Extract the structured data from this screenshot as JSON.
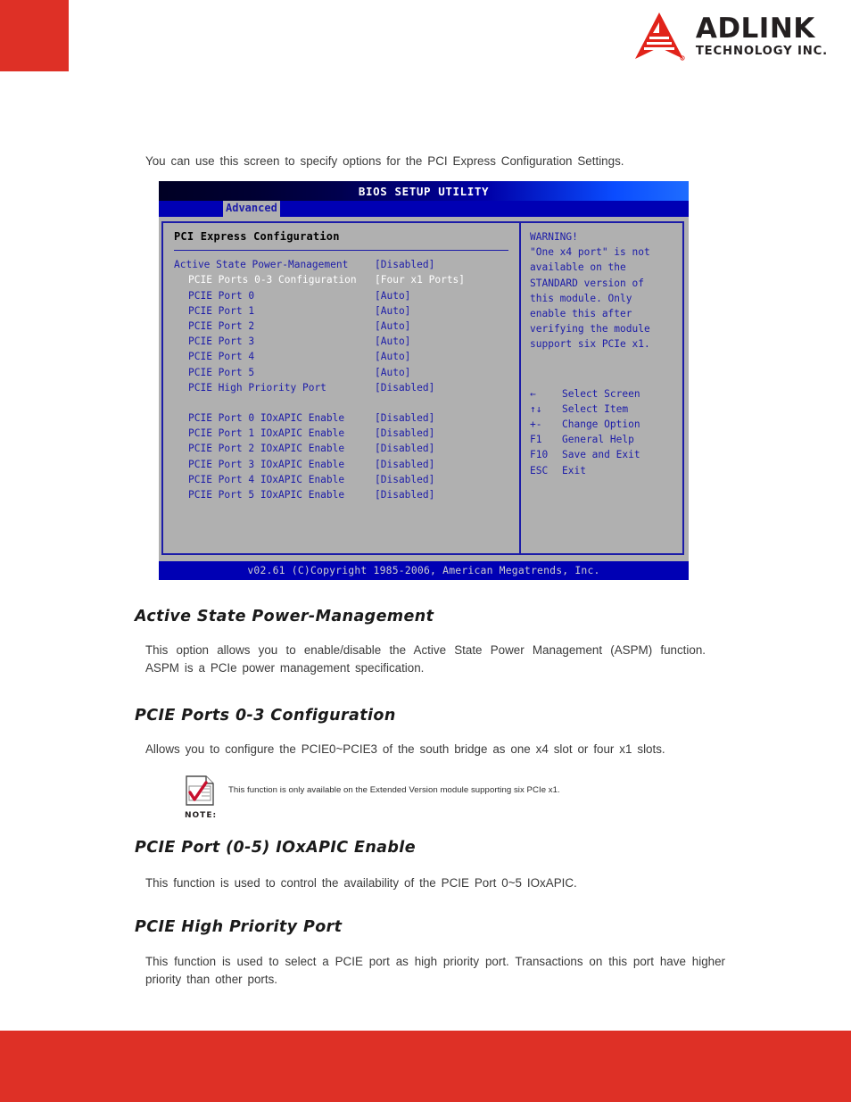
{
  "header": {
    "logo_name": "ADLINK",
    "logo_sub": "TECHNOLOGY INC.",
    "brand_red": "#DE3026"
  },
  "intro": "You can use this screen to specify options for the PCI Express Configuration Settings.",
  "bios": {
    "title": "BIOS SETUP UTILITY",
    "tab": "Advanced",
    "section_title": "PCI Express Configuration",
    "rows": [
      {
        "label": "Active State Power-Management",
        "value": "[Disabled]",
        "indent": false,
        "selected": false
      },
      {
        "label": "PCIE Ports 0-3 Configuration",
        "value": "[Four x1 Ports]",
        "indent": true,
        "selected": true
      },
      {
        "label": "PCIE Port 0",
        "value": "[Auto]",
        "indent": true,
        "selected": false
      },
      {
        "label": "PCIE Port 1",
        "value": "[Auto]",
        "indent": true,
        "selected": false
      },
      {
        "label": "PCIE Port 2",
        "value": "[Auto]",
        "indent": true,
        "selected": false
      },
      {
        "label": "PCIE Port 3",
        "value": "[Auto]",
        "indent": true,
        "selected": false
      },
      {
        "label": "PCIE Port 4",
        "value": "[Auto]",
        "indent": true,
        "selected": false
      },
      {
        "label": "PCIE Port 5",
        "value": "[Auto]",
        "indent": true,
        "selected": false
      },
      {
        "label": "PCIE High Priority Port",
        "value": "[Disabled]",
        "indent": true,
        "selected": false
      },
      {
        "label": "",
        "value": "",
        "indent": false,
        "selected": false
      },
      {
        "label": "PCIE Port 0 IOxAPIC Enable",
        "value": "[Disabled]",
        "indent": true,
        "selected": false
      },
      {
        "label": "PCIE Port 1 IOxAPIC Enable",
        "value": "[Disabled]",
        "indent": true,
        "selected": false
      },
      {
        "label": "PCIE Port 2 IOxAPIC Enable",
        "value": "[Disabled]",
        "indent": true,
        "selected": false
      },
      {
        "label": "PCIE Port 3 IOxAPIC Enable",
        "value": "[Disabled]",
        "indent": true,
        "selected": false
      },
      {
        "label": "PCIE Port 4 IOxAPIC Enable",
        "value": "[Disabled]",
        "indent": true,
        "selected": false
      },
      {
        "label": "PCIE Port 5 IOxAPIC Enable",
        "value": "[Disabled]",
        "indent": true,
        "selected": false
      }
    ],
    "warning": [
      "WARNING!",
      "\"One x4 port\" is not",
      "available on the",
      "STANDARD version of",
      "this module. Only",
      "enable this after",
      "verifying the module",
      "support six PCIe x1."
    ],
    "help": [
      {
        "key": "←",
        "action": "Select Screen"
      },
      {
        "key": "↑↓",
        "action": "Select Item"
      },
      {
        "key": "+-",
        "action": "Change Option"
      },
      {
        "key": "F1",
        "action": "General Help"
      },
      {
        "key": "F10",
        "action": "Save and Exit"
      },
      {
        "key": "ESC",
        "action": "Exit"
      }
    ],
    "footer": "v02.61 (C)Copyright 1985-2006, American Megatrends, Inc."
  },
  "sections": [
    {
      "heading": "Active State Power-Management",
      "body": "This option allows you to enable/disable the Active State Power Management (ASPM) function. ASPM is a PCIe power management specification."
    },
    {
      "heading": "PCIE Ports 0-3 Configuration",
      "body": "Allows you to configure the PCIE0~PCIE3 of the south bridge as one x4 slot or four x1 slots."
    },
    {
      "heading": "PCIE Port (0-5) IOxAPIC Enable",
      "body": "This function is used to control the availability of the PCIE Port 0~5 IOxAPIC."
    },
    {
      "heading": "PCIE High Priority Port",
      "body": "This function is used to select a PCIE port as high priority port. Transactions on this port have higher priority than other ports."
    }
  ],
  "note": {
    "label": "NOTE:",
    "text": "This function is only available on the Extended Version module supporting six PCIe x1."
  }
}
